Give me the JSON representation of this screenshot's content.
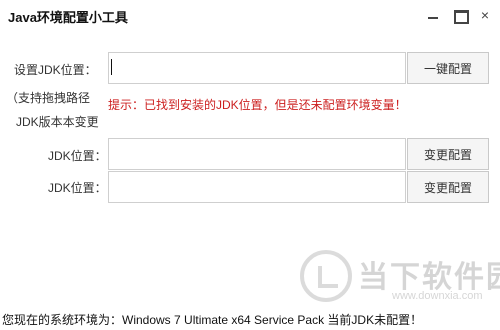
{
  "window": {
    "title": "Java环境配置小工具",
    "controls": {
      "minimize": "minimize",
      "maximize": "maximize",
      "close": "×"
    }
  },
  "form": {
    "jdk_setting": {
      "label": "设置JDK位置：",
      "value": "",
      "button": "一键配置",
      "drag_hint_line1": "（支持拖拽路径",
      "drag_hint_line2": "JDK版本本变更"
    },
    "hint": "提示：已找到安装的JDK位置，但是还未配置环境变量！",
    "jdk_rows": [
      {
        "label": "JDK位置：",
        "value": "",
        "button": "变更配置"
      },
      {
        "label": "JDK位置：",
        "value": "",
        "button": "变更配置"
      }
    ]
  },
  "watermark": {
    "brand": "当下软件园",
    "url": "www.downxia.com"
  },
  "status": "您现在的系统环境为：Windows 7 Ultimate x64 Service Pack 当前JDK未配置！",
  "colors": {
    "hint": "#cc1f1f",
    "button_bg": "#f5f5f5",
    "border": "#cfcfcf"
  }
}
